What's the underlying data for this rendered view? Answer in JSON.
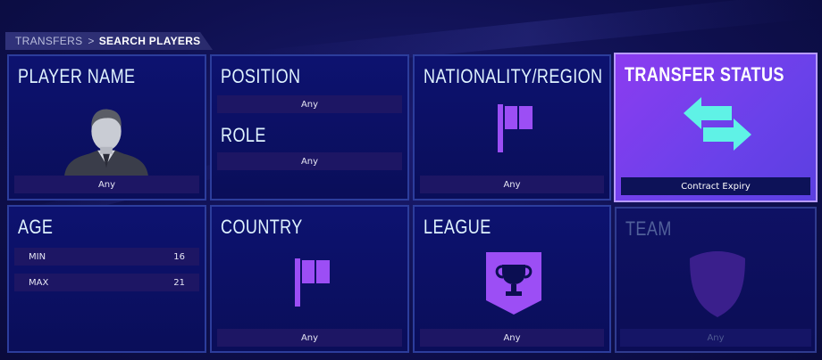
{
  "breadcrumb": {
    "parent": "TRANSFERS",
    "separator": ">",
    "current": "SEARCH PLAYERS"
  },
  "tiles": {
    "player_name": {
      "title": "PLAYER NAME",
      "value": "Any"
    },
    "position": {
      "title": "POSITION",
      "value": "Any",
      "role_title": "ROLE",
      "role_value": "Any"
    },
    "nationality": {
      "title": "NATIONALITY/REGION",
      "value": "Any"
    },
    "transfer_status": {
      "title": "TRANSFER STATUS",
      "value": "Contract Expiry"
    },
    "age": {
      "title": "AGE",
      "min_label": "MIN",
      "min_value": "16",
      "max_label": "MAX",
      "max_value": "21"
    },
    "country": {
      "title": "COUNTRY",
      "value": "Any"
    },
    "league": {
      "title": "LEAGUE",
      "value": "Any"
    },
    "team": {
      "title": "TEAM",
      "value": "Any"
    }
  },
  "icons": {
    "player_name": "player-silhouette-icon",
    "nationality": "flag-icon",
    "transfer_status": "transfer-arrows-icon",
    "country": "flag-icon",
    "league": "trophy-badge-icon",
    "team": "crest-shield-icon"
  },
  "colors": {
    "tile_bg": "#0d1270",
    "tile_border": "#2c3d9c",
    "accent_purple": "#8c3cf0",
    "arrow_cyan": "#5ff2e6",
    "icon_purple": "#9c4ef5",
    "field_bar": "#1d1664"
  }
}
